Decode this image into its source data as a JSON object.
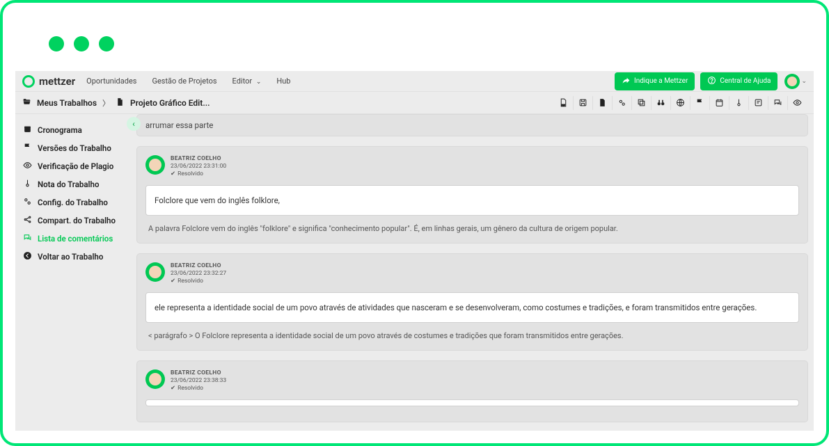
{
  "brand": "mettzer",
  "nav": {
    "items": [
      {
        "label": "Oportunidades"
      },
      {
        "label": "Gestão de Projetos"
      },
      {
        "label": "Editor",
        "dropdown": true
      },
      {
        "label": "Hub"
      }
    ],
    "indicate_btn": "Indique a Mettzer",
    "help_btn": "Central de Ajuda"
  },
  "breadcrumb": {
    "root": "Meus Trabalhos",
    "current": "Projeto Gráfico Edit..."
  },
  "toolbar_icons": [
    "pdf-icon",
    "save-icon",
    "document-icon",
    "settings-icon",
    "copy-icon",
    "binoculars-icon",
    "globe-icon",
    "flag-icon",
    "calendar-icon",
    "thermometer-icon",
    "note-icon",
    "comments-icon",
    "eye-icon"
  ],
  "sidebar": {
    "items": [
      {
        "icon": "calendar-icon",
        "label": "Cronograma"
      },
      {
        "icon": "flag-icon",
        "label": "Versões do Trabalho"
      },
      {
        "icon": "eye-icon",
        "label": "Verificação de Plagio"
      },
      {
        "icon": "thermometer-icon",
        "label": "Nota do Trabalho"
      },
      {
        "icon": "cogs-icon",
        "label": "Config. do Trabalho"
      },
      {
        "icon": "share-icon",
        "label": "Compart. do Trabalho"
      },
      {
        "icon": "comments-icon",
        "label": "Lista de comentários",
        "active": true
      },
      {
        "icon": "back-icon",
        "label": "Voltar ao Trabalho"
      }
    ]
  },
  "fragment_top": "arrumar essa parte",
  "comments": [
    {
      "author": "BEATRIZ COELHO",
      "date": "23/06/2022 23:31:00",
      "status": "Resolvido",
      "body": "Folclore que vem do inglês folklore,",
      "quote": "A palavra Folclore vem do inglês \"folklore\" e significa \"conhecimento popular\". É, em linhas gerais, um gênero da cultura de origem popular."
    },
    {
      "author": "BEATRIZ COELHO",
      "date": "23/06/2022 23:32:27",
      "status": "Resolvido",
      "body": "ele representa a identidade social de um povo através de atividades que nasceram e se desenvolveram, como costumes e tradições, e foram transmitidos entre gerações.",
      "quote": "< parágrafo > O Folclore representa a identidade social de um povo através de costumes e tradições que foram transmitidos entre gerações."
    },
    {
      "author": "BEATRIZ COELHO",
      "date": "23/06/2022 23:38:33",
      "status": "Resolvido",
      "body": "",
      "quote": ""
    }
  ]
}
